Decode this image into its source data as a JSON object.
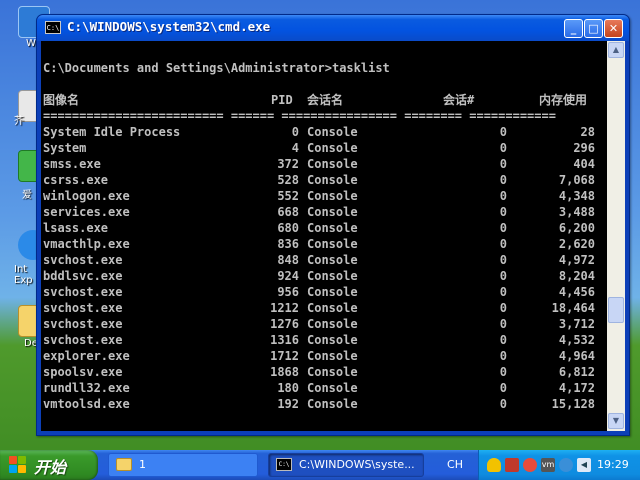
{
  "desktop": {
    "icon_labels": [
      "W",
      "芥",
      "爱",
      "Int\nExp",
      "De"
    ]
  },
  "window": {
    "title": "C:\\WINDOWS\\system32\\cmd.exe",
    "icon_text": "C:\\"
  },
  "console": {
    "command_line": "C:\\Documents and Settings\\Administrator>tasklist",
    "headers": {
      "image": "图像名",
      "pid": "PID",
      "session_name": "会话名",
      "session_num": "会话#",
      "mem": "内存使用"
    },
    "separator": "========================= ====== ================ ======== ============",
    "rows": [
      {
        "image": "System Idle Process",
        "pid": "0",
        "session": "Console",
        "num": "0",
        "mem": "28"
      },
      {
        "image": "System",
        "pid": "4",
        "session": "Console",
        "num": "0",
        "mem": "296"
      },
      {
        "image": "smss.exe",
        "pid": "372",
        "session": "Console",
        "num": "0",
        "mem": "404"
      },
      {
        "image": "csrss.exe",
        "pid": "528",
        "session": "Console",
        "num": "0",
        "mem": "7,068"
      },
      {
        "image": "winlogon.exe",
        "pid": "552",
        "session": "Console",
        "num": "0",
        "mem": "4,348"
      },
      {
        "image": "services.exe",
        "pid": "668",
        "session": "Console",
        "num": "0",
        "mem": "3,488"
      },
      {
        "image": "lsass.exe",
        "pid": "680",
        "session": "Console",
        "num": "0",
        "mem": "6,200"
      },
      {
        "image": "vmacthlp.exe",
        "pid": "836",
        "session": "Console",
        "num": "0",
        "mem": "2,620"
      },
      {
        "image": "svchost.exe",
        "pid": "848",
        "session": "Console",
        "num": "0",
        "mem": "4,972"
      },
      {
        "image": "bddlsvc.exe",
        "pid": "924",
        "session": "Console",
        "num": "0",
        "mem": "8,204"
      },
      {
        "image": "svchost.exe",
        "pid": "956",
        "session": "Console",
        "num": "0",
        "mem": "4,456"
      },
      {
        "image": "svchost.exe",
        "pid": "1212",
        "session": "Console",
        "num": "0",
        "mem": "18,464"
      },
      {
        "image": "svchost.exe",
        "pid": "1276",
        "session": "Console",
        "num": "0",
        "mem": "3,712"
      },
      {
        "image": "svchost.exe",
        "pid": "1316",
        "session": "Console",
        "num": "0",
        "mem": "4,532"
      },
      {
        "image": "explorer.exe",
        "pid": "1712",
        "session": "Console",
        "num": "0",
        "mem": "4,964"
      },
      {
        "image": "spoolsv.exe",
        "pid": "1868",
        "session": "Console",
        "num": "0",
        "mem": "6,812"
      },
      {
        "image": "rundll32.exe",
        "pid": "180",
        "session": "Console",
        "num": "0",
        "mem": "4,172"
      },
      {
        "image": "vmtoolsd.exe",
        "pid": "192",
        "session": "Console",
        "num": "0",
        "mem": "15,128"
      }
    ]
  },
  "taskbar": {
    "start_label": "开始",
    "buttons": [
      {
        "label": "1",
        "icon": "folder-icon"
      },
      {
        "label": "C:\\WINDOWS\\syste...",
        "icon": "cmd-icon"
      }
    ],
    "language": "CH",
    "clock": "19:29"
  },
  "colors": {
    "titlebar": "#0353e0",
    "console_bg": "#000000",
    "console_text": "#c0c0c0",
    "taskbar": "#245ddb",
    "start_button": "#3a9a2a",
    "tray": "#0f8ce0"
  }
}
